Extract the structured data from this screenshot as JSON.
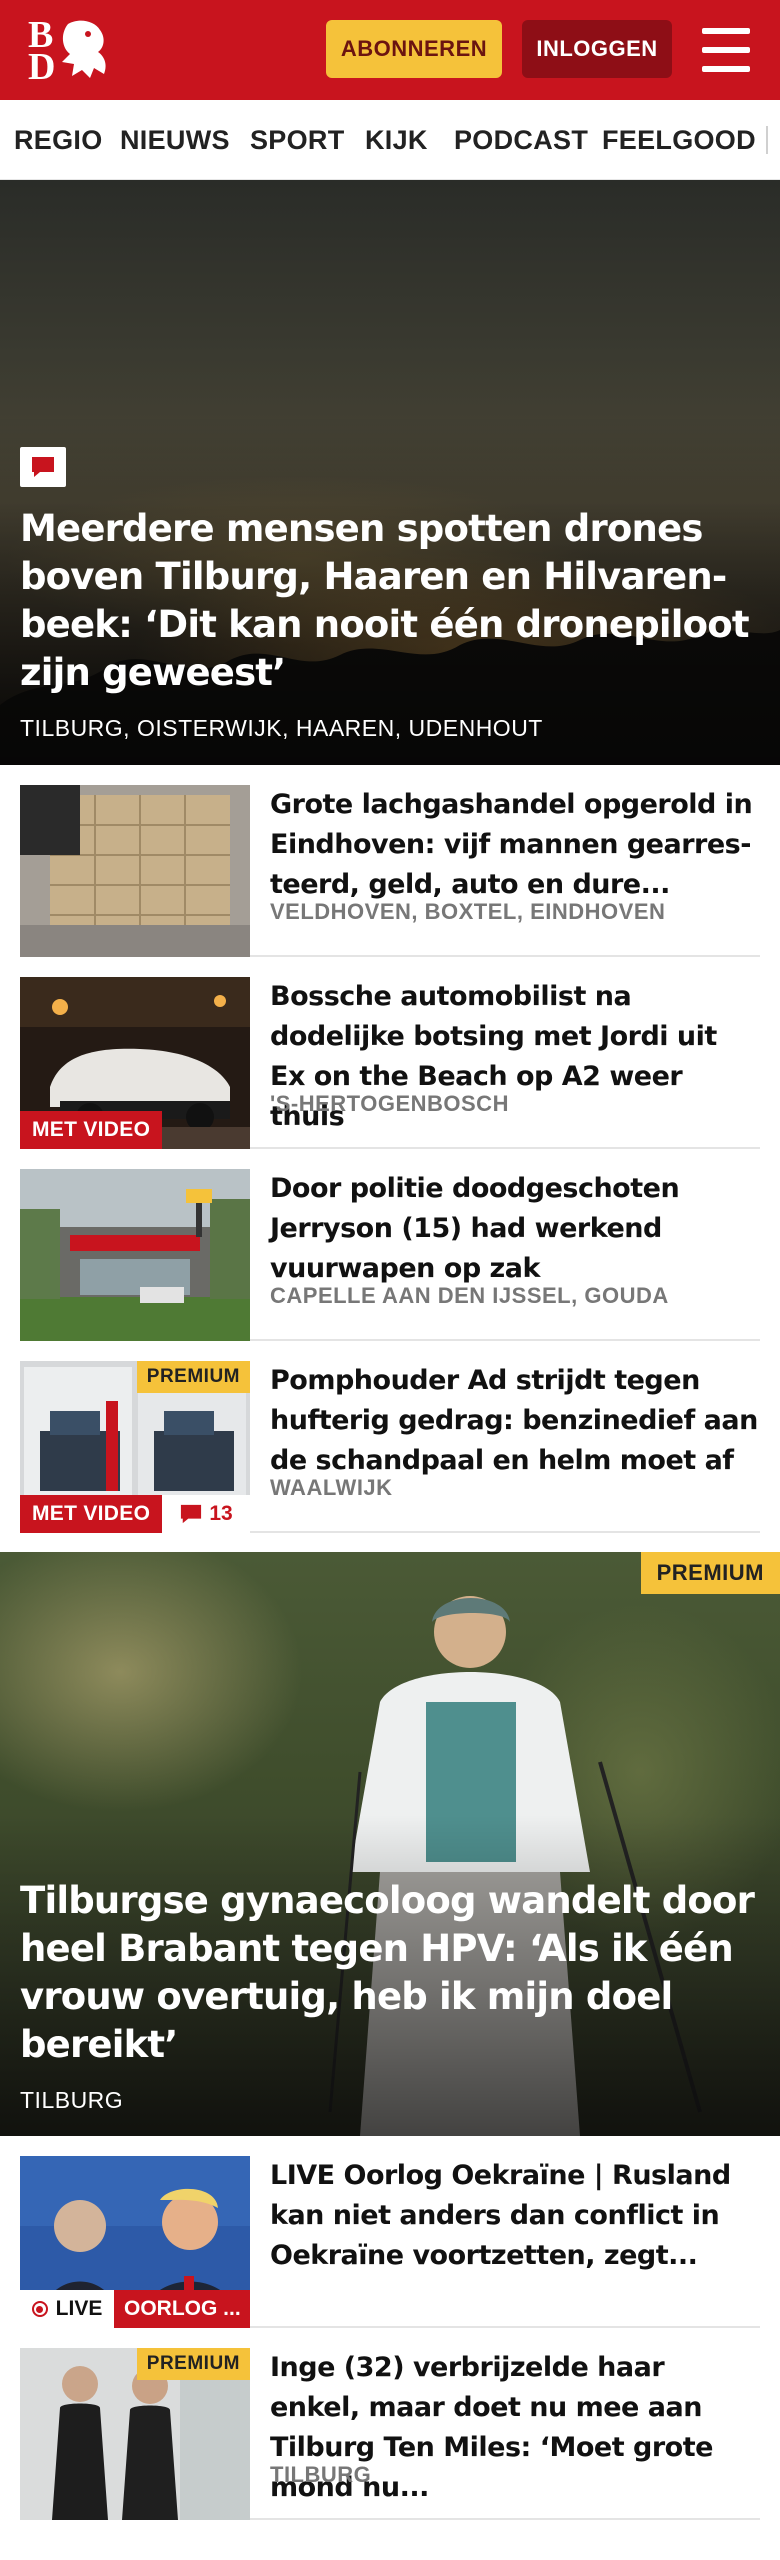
{
  "header": {
    "logo_text": [
      "B",
      "D"
    ],
    "subscribe_label": "ABONNEREN",
    "login_label": "INLOGGEN",
    "menu_icon": "hamburger-menu-icon",
    "colors": {
      "brand_red": "#c8141e",
      "login_dark_red": "#8e0e16",
      "subscribe_yellow": "#f5c23a"
    }
  },
  "nav": {
    "items": [
      "REGIO",
      "NIEUWS",
      "SPORT",
      "KIJK",
      "PODCAST",
      "FEELGOOD"
    ]
  },
  "hero": {
    "badge_icon": "comment-icon",
    "title": "Meerdere mensen spotten drones boven Tilburg, Haaren en Hilvaren-beek: ‘Dit kan nooit één dronepiloot zijn geweest’",
    "location": "TILBURG, OISTERWIJK, HAAREN, UDENHOUT"
  },
  "articles": [
    {
      "title": "Grote lachgashandel opgerold in Eindhoven: vijf mannen gearres-teerd, geld, auto en dure...",
      "location": "VELDHOVEN, BOXTEL, EINDHOVEN"
    },
    {
      "title": "Bossche automobilist na dodelijke botsing met Jordi uit Ex on the Beach op A2 weer thuis",
      "location": "'S-HERTOGENBOSCH",
      "video_label": "MET VIDEO"
    },
    {
      "title": "Door politie doodgeschoten Jerryson (15) had werkend vuurwapen op zak",
      "location": "CAPELLE AAN DEN IJSSEL, GOUDA"
    },
    {
      "title": "Pomphouder Ad strijdt tegen hufterig gedrag: benzinedief aan de schandpaal en helm moet af",
      "location": "WAALWIJK",
      "video_label": "MET VIDEO",
      "premium_label": "PREMIUM",
      "comment_count": "13"
    }
  ],
  "feature": {
    "premium_label": "PREMIUM",
    "title": "Tilburgse gynaecoloog wandelt door heel Brabant tegen HPV: ‘Als ik één vrouw overtuig, heb ik mijn doel bereikt’",
    "location": "TILBURG"
  },
  "articles2": [
    {
      "title": "LIVE Oorlog Oekraïne | Rusland kan niet anders dan conflict in Oekraïne voortzetten, zegt...",
      "live_label": "LIVE",
      "topic_label": "OORLOG ..."
    },
    {
      "title": "Inge (32) verbrijzelde haar enkel, maar doet nu mee aan Tilburg Ten Miles: ‘Moet grote mond nu...",
      "location": "TILBURG",
      "premium_label": "PREMIUM"
    }
  ]
}
